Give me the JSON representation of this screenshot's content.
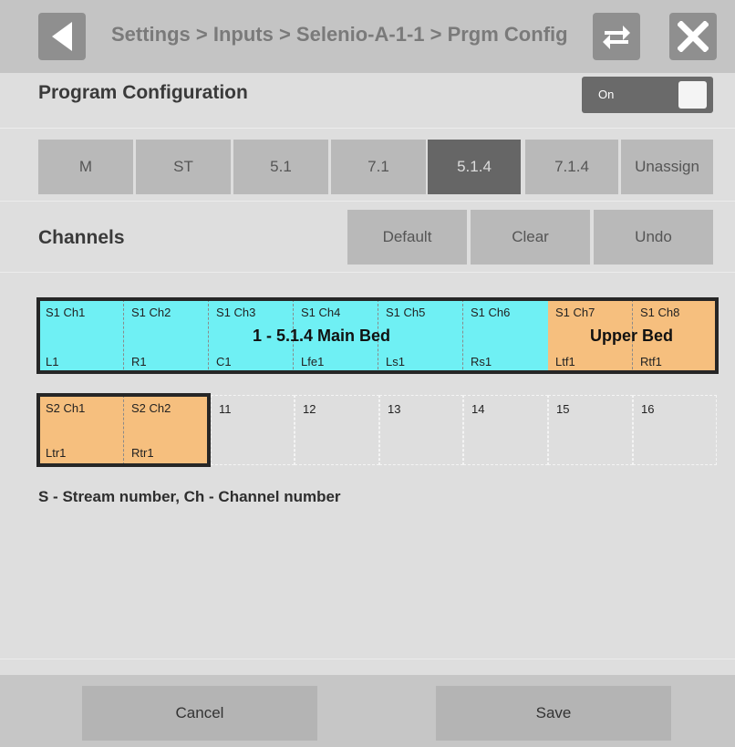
{
  "header": {
    "breadcrumb": "Settings > Inputs > Selenio-A-1-1 > Prgm Config",
    "back_icon": "back-arrow-icon",
    "swap_icon": "swap-arrows-icon",
    "close_icon": "close-x-icon"
  },
  "program": {
    "title": "Program Configuration",
    "toggle_label": "On",
    "toggle_state": true
  },
  "config_buttons": {
    "items": [
      "M",
      "ST",
      "5.1",
      "7.1",
      "5.1.4",
      "7.1.4",
      "Unassign"
    ],
    "selected": "5.1.4"
  },
  "channels": {
    "title": "Channels",
    "default_label": "Default",
    "clear_label": "Clear",
    "undo_label": "Undo"
  },
  "grid": {
    "row1": [
      {
        "top": "S1 Ch1",
        "bottom": "L1"
      },
      {
        "top": "S1 Ch2",
        "bottom": "R1"
      },
      {
        "top": "S1 Ch3",
        "bottom": "C1"
      },
      {
        "top": "S1 Ch4",
        "bottom": "Lfe1"
      },
      {
        "top": "S1 Ch5",
        "bottom": "Ls1"
      },
      {
        "top": "S1 Ch6",
        "bottom": "Rs1"
      },
      {
        "top": "S1 Ch7",
        "bottom": "Ltf1"
      },
      {
        "top": "S1 Ch8",
        "bottom": "Rtf1"
      }
    ],
    "row2": [
      {
        "top": "S2 Ch1",
        "bottom": "Ltr1"
      },
      {
        "top": "S2 Ch2",
        "bottom": "Rtr1"
      },
      {
        "top": "11",
        "bottom": ""
      },
      {
        "top": "12",
        "bottom": ""
      },
      {
        "top": "13",
        "bottom": ""
      },
      {
        "top": "14",
        "bottom": ""
      },
      {
        "top": "15",
        "bottom": ""
      },
      {
        "top": "16",
        "bottom": ""
      }
    ],
    "main_bed_label": "1 - 5.1.4 Main Bed",
    "upper_bed_label": "Upper Bed",
    "colors": {
      "main_bed": "#6ff0f4",
      "upper_bed": "#f6bf7e"
    }
  },
  "note": "S - Stream number, Ch - Channel number",
  "footer": {
    "cancel_label": "Cancel",
    "save_label": "Save"
  }
}
